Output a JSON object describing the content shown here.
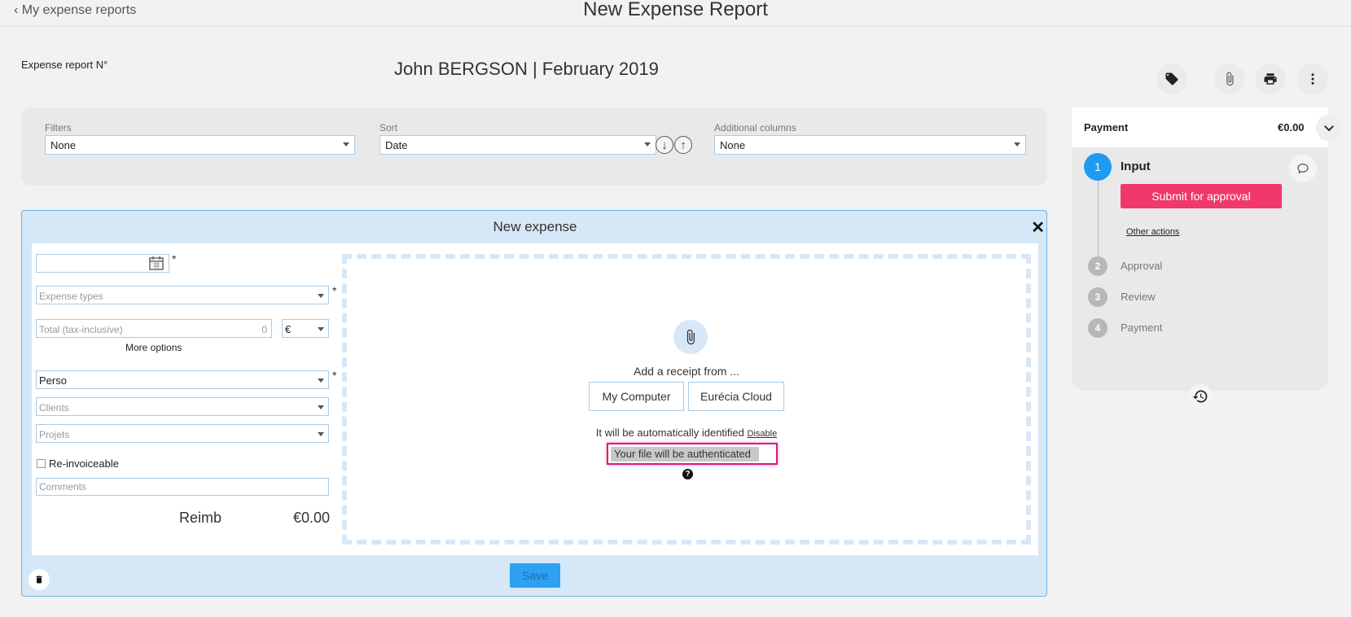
{
  "header": {
    "back_link": "My expense reports",
    "title": "New Expense Report"
  },
  "report": {
    "number_label": "Expense report N°",
    "name": "John BERGSON | February 2019"
  },
  "toolbar_icons": [
    "tag-icon",
    "paperclip-icon",
    "print-icon",
    "more-vertical-icon"
  ],
  "filters": {
    "filters_label": "Filters",
    "filters_value": "None",
    "sort_label": "Sort",
    "sort_value": "Date",
    "columns_label": "Additional columns",
    "columns_value": "None"
  },
  "expense": {
    "title": "New expense",
    "close": "✕",
    "date_value": "",
    "required_mark": "*",
    "expense_types_placeholder": "Expense types",
    "total_placeholder": "Total (tax-inclusive)",
    "total_value": "0",
    "currency": "€",
    "more_options": "More options",
    "account_value": "Perso",
    "clients_placeholder": "Clients",
    "projects_placeholder": "Projets",
    "reinvoiceable_label": "Re-invoiceable",
    "comments_placeholder": "Comments",
    "reimb_label": "Reimb",
    "reimb_value": "€0.00",
    "save_label": "Save"
  },
  "receipt": {
    "add_from": "Add a receipt from ...",
    "my_computer": "My Computer",
    "eurecia_cloud": "Eurécia Cloud",
    "auto_identified": "It will be automatically identified",
    "disable": "Disable",
    "authenticated": "Your file will be authenticated",
    "help": "?"
  },
  "workflow": {
    "header_label": "Payment",
    "header_amount": "€0.00",
    "steps": [
      {
        "num": "1",
        "label": "Input"
      },
      {
        "num": "2",
        "label": "Approval"
      },
      {
        "num": "3",
        "label": "Review"
      },
      {
        "num": "4",
        "label": "Payment"
      }
    ],
    "submit_label": "Submit for approval",
    "other_actions": "Other actions"
  },
  "colors": {
    "accent": "#1e9bf0",
    "submit": "#f0386b",
    "highlight": "#d81b7a",
    "panel": "#d6e8f7"
  }
}
